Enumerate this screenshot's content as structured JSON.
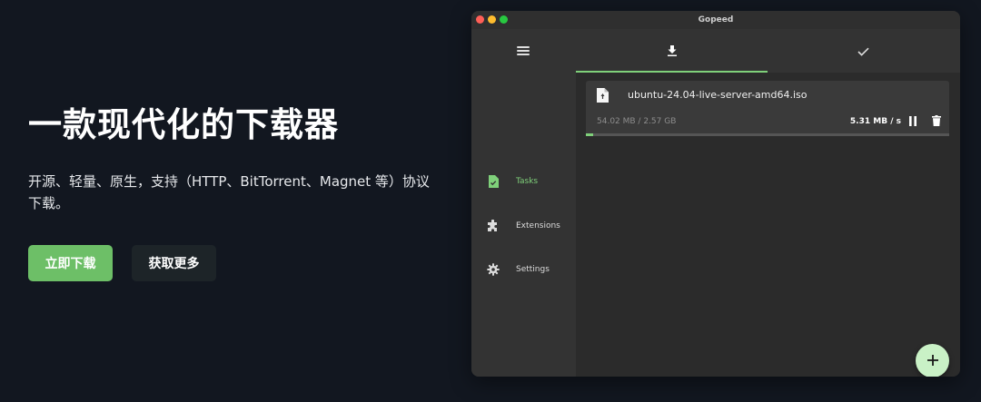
{
  "hero": {
    "title": "一款现代化的下载器",
    "description": "开源、轻量、原生，支持（HTTP、BitTorrent、Magnet 等）协议下载。",
    "primary_button": "立即下载",
    "secondary_button": "获取更多"
  },
  "window": {
    "title": "Gopeed"
  },
  "sidebar": {
    "items": [
      {
        "label": "Tasks",
        "icon": "task-file-icon",
        "active": true
      },
      {
        "label": "Extensions",
        "icon": "puzzle-icon",
        "active": false
      },
      {
        "label": "Settings",
        "icon": "gear-icon",
        "active": false
      }
    ]
  },
  "tabs": [
    {
      "icon": "download-icon",
      "active": true
    },
    {
      "icon": "check-icon",
      "active": false
    }
  ],
  "task": {
    "name": "ubuntu-24.04-live-server-amd64.iso",
    "size": "54.02 MB / 2.57 GB",
    "speed": "5.31 MB / s",
    "progress_fraction": 0.021
  },
  "colors": {
    "accent": "#7fd07a",
    "button_green": "#6dbf67",
    "background": "#121720",
    "fab": "#c9f1c6"
  }
}
